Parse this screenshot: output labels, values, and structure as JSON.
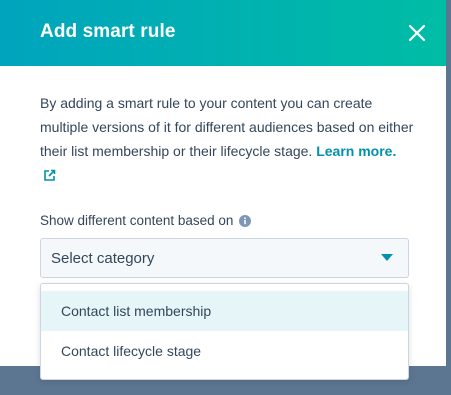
{
  "modal": {
    "title": "Add smart rule",
    "description_text": "By adding a smart rule to your content you can create multiple versions of it for different audiences based on either their list membership or their lifecycle stage.",
    "learn_more_link": "Learn more.",
    "header_gradient": [
      "#00a4bd",
      "#00bda5"
    ],
    "link_color": "#0091ae"
  },
  "field": {
    "label": "Show different content based on",
    "selected_value": "Select category",
    "caret_color": "#0091ae"
  },
  "dropdown": {
    "options": [
      {
        "label": "Contact list membership",
        "highlighted": true
      },
      {
        "label": "Contact lifecycle stage",
        "highlighted": false
      }
    ]
  },
  "icons": {
    "close": "close-icon",
    "external_link": "external-link-icon",
    "info": "info-icon",
    "caret": "caret-down-icon"
  }
}
